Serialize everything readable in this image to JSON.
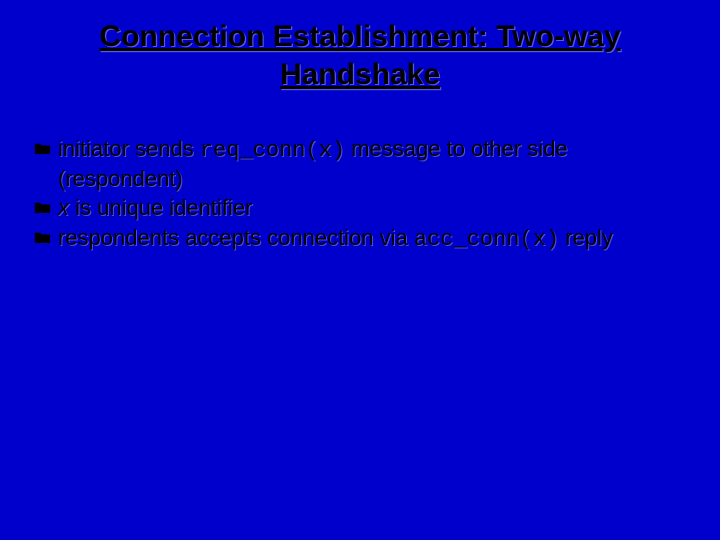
{
  "title": "Connection Establishment: Two-way Handshake",
  "bullets": {
    "b1": {
      "pre": "initiator sends ",
      "code": "req_conn(x)",
      "post": " message to other side (respondent)"
    },
    "b2": {
      "ital": "x",
      "post": " is unique identifier"
    },
    "b3": {
      "pre": "respondents accepts connection via ",
      "code": "acc_conn(x)",
      "post": " reply"
    }
  }
}
